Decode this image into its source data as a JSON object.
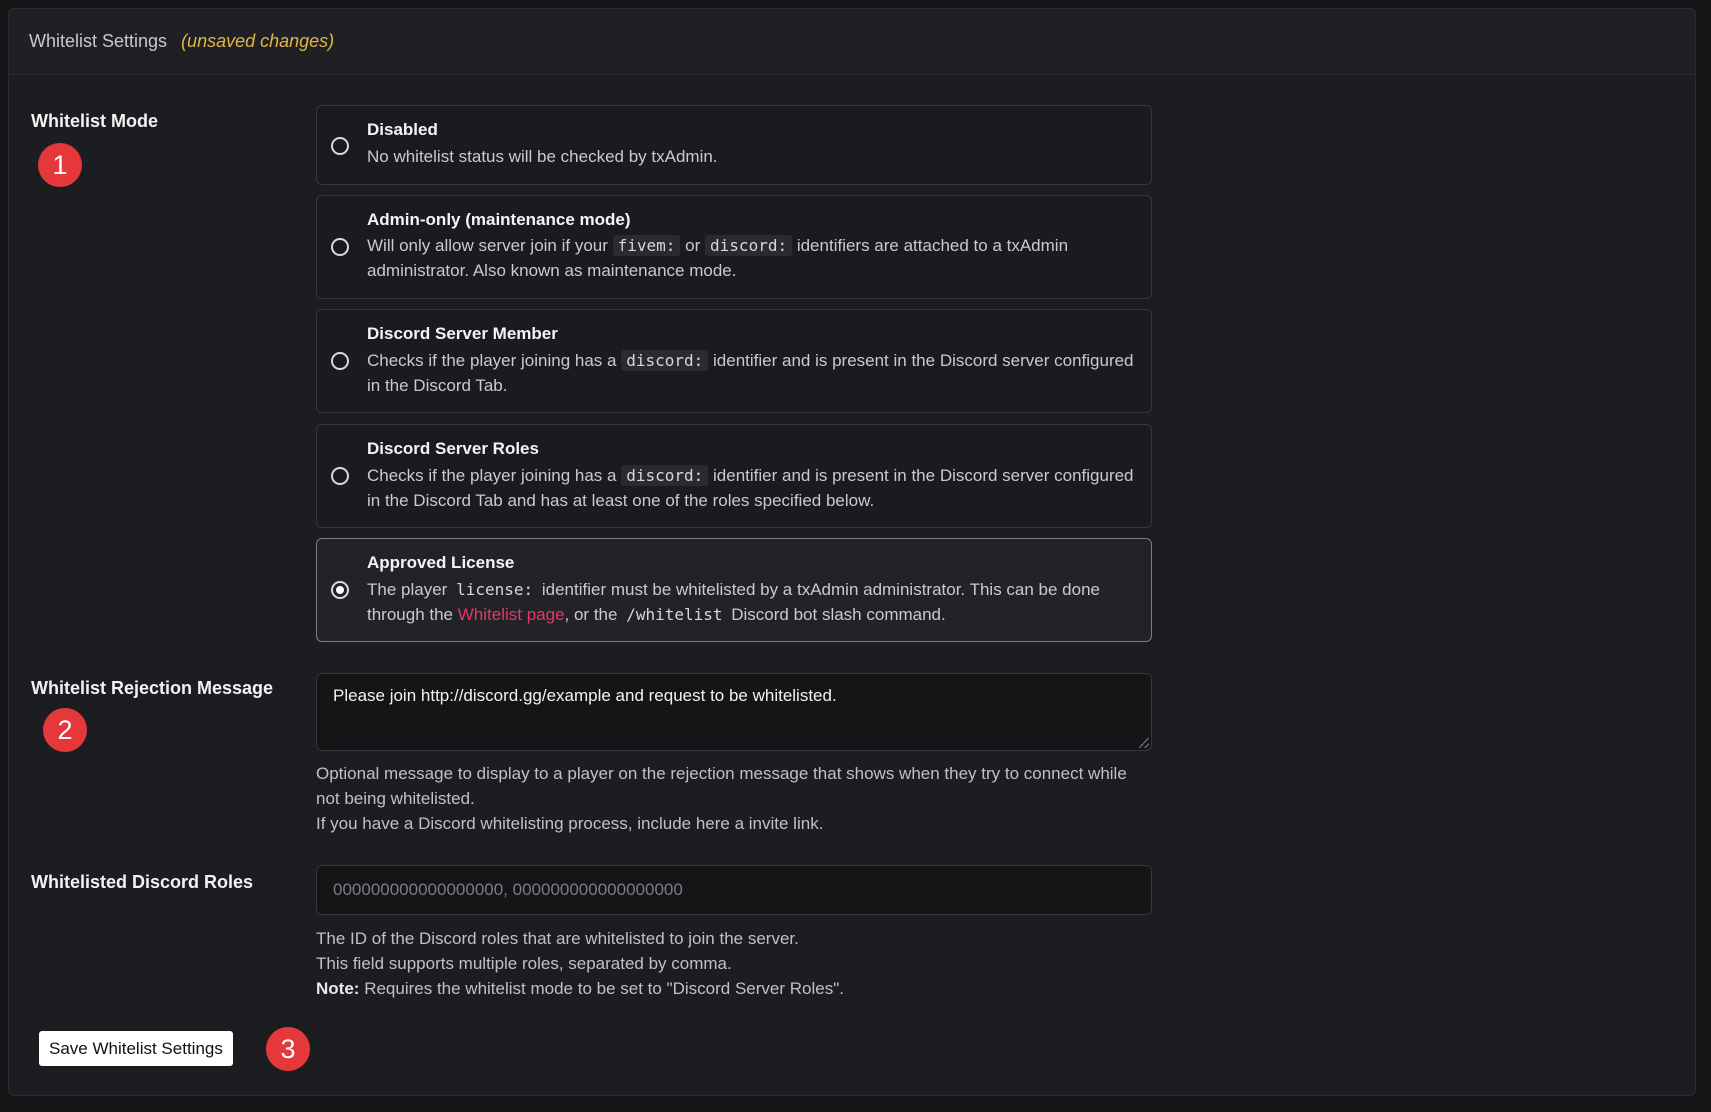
{
  "header": {
    "title": "Whitelist Settings",
    "unsaved": "(unsaved changes)"
  },
  "whitelist_mode": {
    "label": "Whitelist Mode",
    "badge": "1",
    "options": [
      {
        "title": "Disabled",
        "desc": "No whitelist status will be checked by txAdmin.",
        "selected": false
      },
      {
        "title": "Admin-only (maintenance mode)",
        "desc_parts": [
          "Will only allow server join if your",
          "fivem:",
          "or",
          "discord:",
          "identifiers are attached to a txAdmin administrator. Also known as maintenance mode."
        ],
        "selected": false
      },
      {
        "title": "Discord Server Member",
        "desc_parts": [
          "Checks if the player joining has a",
          "discord:",
          "identifier and is present in the Discord server configured in the Discord Tab."
        ],
        "selected": false
      },
      {
        "title": "Discord Server Roles",
        "desc_parts": [
          "Checks if the player joining has a",
          "discord:",
          "identifier and is present in the Discord server configured in the Discord Tab and has at least one of the roles specified below."
        ],
        "selected": false
      },
      {
        "title": "Approved License",
        "desc_parts": [
          "The player",
          "license:",
          "identifier must be whitelisted by a txAdmin administrator. This can be done through the",
          "Whitelist page",
          ", or the",
          "/whitelist",
          "Discord bot slash command."
        ],
        "selected": true
      }
    ]
  },
  "rejection": {
    "label": "Whitelist Rejection Message",
    "badge": "2",
    "value": "Please join http://discord.gg/example and request to be whitelisted.",
    "help_line1": "Optional message to display to a player on the rejection message that shows when they try to connect while not being whitelisted.",
    "help_line2": "If you have a Discord whitelisting process, include here a invite link."
  },
  "roles": {
    "label": "Whitelisted Discord Roles",
    "placeholder": "000000000000000000, 000000000000000000",
    "help_line1": "The ID of the Discord roles that are whitelisted to join the server.",
    "help_line2": "This field supports multiple roles, separated by comma.",
    "note_label": "Note:",
    "note_text": "Requires the whitelist mode to be set to \"Discord Server Roles\"."
  },
  "save": {
    "label": "Save Whitelist Settings",
    "badge": "3"
  },
  "colors": {
    "accent_link": "#e8336b",
    "badge_red": "#e5383b",
    "unsaved_yellow": "#e2b646"
  }
}
